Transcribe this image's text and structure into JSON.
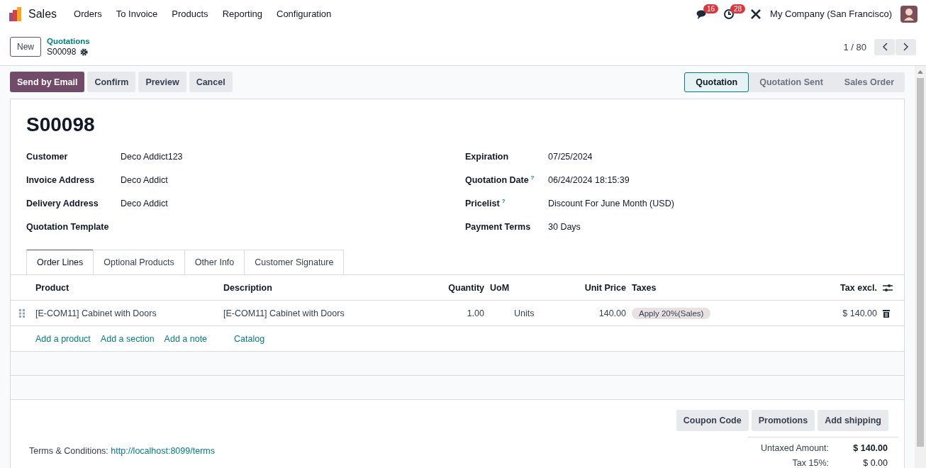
{
  "navbar": {
    "app": "Sales",
    "menu": [
      "Orders",
      "To Invoice",
      "Products",
      "Reporting",
      "Configuration"
    ],
    "messages_count": "16",
    "activities_count": "28",
    "company": "My Company (San Francisco)"
  },
  "control_panel": {
    "new_button": "New",
    "breadcrumb_parent": "Quotations",
    "breadcrumb_current": "S00098",
    "pager": "1 / 80"
  },
  "actions": [
    {
      "label": "Send by Email",
      "kind": "primary"
    },
    {
      "label": "Confirm",
      "kind": "secondary"
    },
    {
      "label": "Preview",
      "kind": "secondary"
    },
    {
      "label": "Cancel",
      "kind": "secondary"
    }
  ],
  "status_steps": [
    {
      "label": "Quotation",
      "selected": true
    },
    {
      "label": "Quotation Sent",
      "selected": false
    },
    {
      "label": "Sales Order",
      "selected": false
    }
  ],
  "record": {
    "name": "S00098",
    "fields_left": [
      {
        "label": "Customer",
        "value": "Deco Addict123"
      },
      {
        "label": "Invoice Address",
        "value": "Deco Addict"
      },
      {
        "label": "Delivery Address",
        "value": "Deco Addict"
      },
      {
        "label": "Quotation Template"
      }
    ],
    "fields_right": [
      {
        "label": "Expiration",
        "value": "07/25/2024"
      },
      {
        "label": "Quotation Date",
        "help": "?",
        "value": "06/24/2024 18:15:39"
      },
      {
        "label": "Pricelist",
        "help": "?",
        "value": "Discount For June Month (USD)"
      },
      {
        "label": "Payment Terms",
        "value": "30 Days"
      }
    ]
  },
  "tabs": [
    {
      "label": "Order Lines",
      "selected": true
    },
    {
      "label": "Optional Products",
      "selected": false
    },
    {
      "label": "Other Info",
      "selected": false
    },
    {
      "label": "Customer Signature",
      "selected": false
    }
  ],
  "table": {
    "columns": [
      "Product",
      "Description",
      "Quantity",
      "UoM",
      "Unit Price",
      "Taxes",
      "Tax excl."
    ],
    "rows": [
      {
        "product": "[E-COM11] Cabinet with Doors",
        "description": "[E-COM11] Cabinet with Doors",
        "quantity": "1.00",
        "uom": "Units",
        "unit_price": "140.00",
        "tax": "Apply 20%(Sales)",
        "subtotal": "$ 140.00"
      }
    ],
    "add_links": [
      "Add a product",
      "Add a section",
      "Add a note",
      "Catalog"
    ]
  },
  "footer": {
    "buttons": [
      "Coupon Code",
      "Promotions",
      "Add shipping"
    ],
    "terms_label": "Terms & Conditions:",
    "terms_link": "http://localhost:8099/terms",
    "totals": [
      {
        "label": "Untaxed Amount:",
        "value": "$ 140.00",
        "bold": true
      },
      {
        "label": "Tax 15%:",
        "value": "$ 0.00",
        "bold": false
      }
    ]
  }
}
